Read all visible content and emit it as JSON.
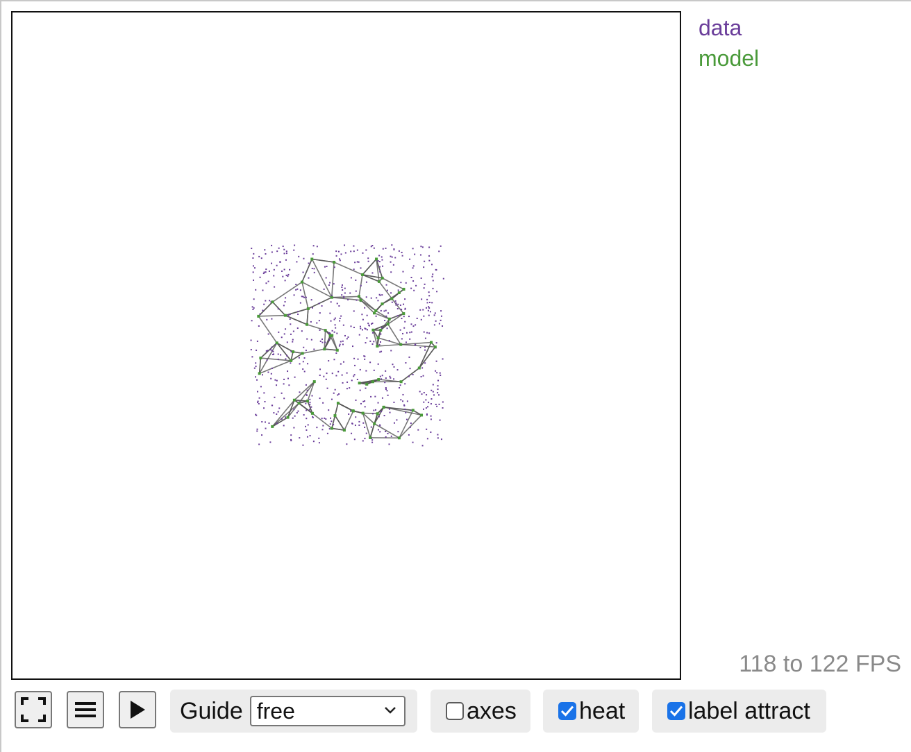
{
  "legend": {
    "data_label": "data",
    "model_label": "model"
  },
  "colors": {
    "data": "#6a3d9a",
    "model": "#4a9a3a",
    "edge": "#555555"
  },
  "icons": {
    "fullscreen": "fullscreen-icon",
    "menu": "hamburger-menu-icon",
    "play": "play-icon"
  },
  "status": {
    "fps": "118 to 122 FPS"
  },
  "controls": {
    "guide_label": "Guide",
    "guide_value": "free",
    "axes_label": "axes",
    "axes_checked": false,
    "heat_label": "heat",
    "heat_checked": true,
    "label_attract_label": "label attract",
    "label_attract_checked": true
  }
}
